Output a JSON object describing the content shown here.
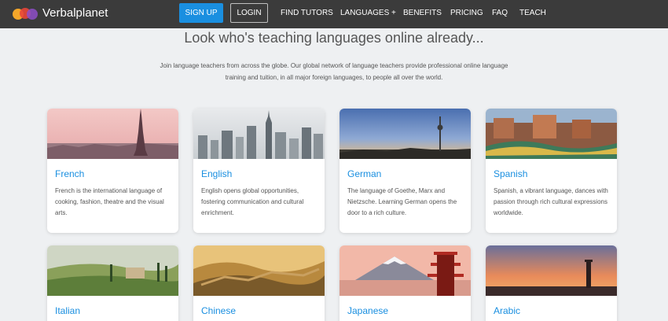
{
  "nav": {
    "brand": "Verbalplanet",
    "signup": "SIGN UP",
    "login": "LOGIN",
    "links": [
      "FIND TUTORS",
      "LANGUAGES +",
      "BENEFITS",
      "PRICING",
      "FAQ",
      "TEACH"
    ]
  },
  "main": {
    "heading": "Look who's teaching languages online already...",
    "intro": "Join language teachers from across the globe. Our global network of language teachers provide professional online language training and tuition, in all major foreign languages, to people all over the world."
  },
  "cards": [
    {
      "title": "French",
      "desc": "French is the international language of cooking, fashion, theatre and the visual arts."
    },
    {
      "title": "English",
      "desc": "English opens global opportunities, fostering communication and cultural enrichment."
    },
    {
      "title": "German",
      "desc": "The language of Goethe, Marx and Nietzsche. Learning German opens the door to a rich culture."
    },
    {
      "title": "Spanish",
      "desc": "Spanish, a vibrant language, dances with passion through rich cultural expressions worldwide."
    },
    {
      "title": "Italian",
      "desc": ""
    },
    {
      "title": "Chinese",
      "desc": ""
    },
    {
      "title": "Japanese",
      "desc": ""
    },
    {
      "title": "Arabic",
      "desc": ""
    }
  ],
  "colors": {
    "accent": "#1a8fe0",
    "navbar": "#3b3b3b",
    "background": "#eef0f2"
  }
}
